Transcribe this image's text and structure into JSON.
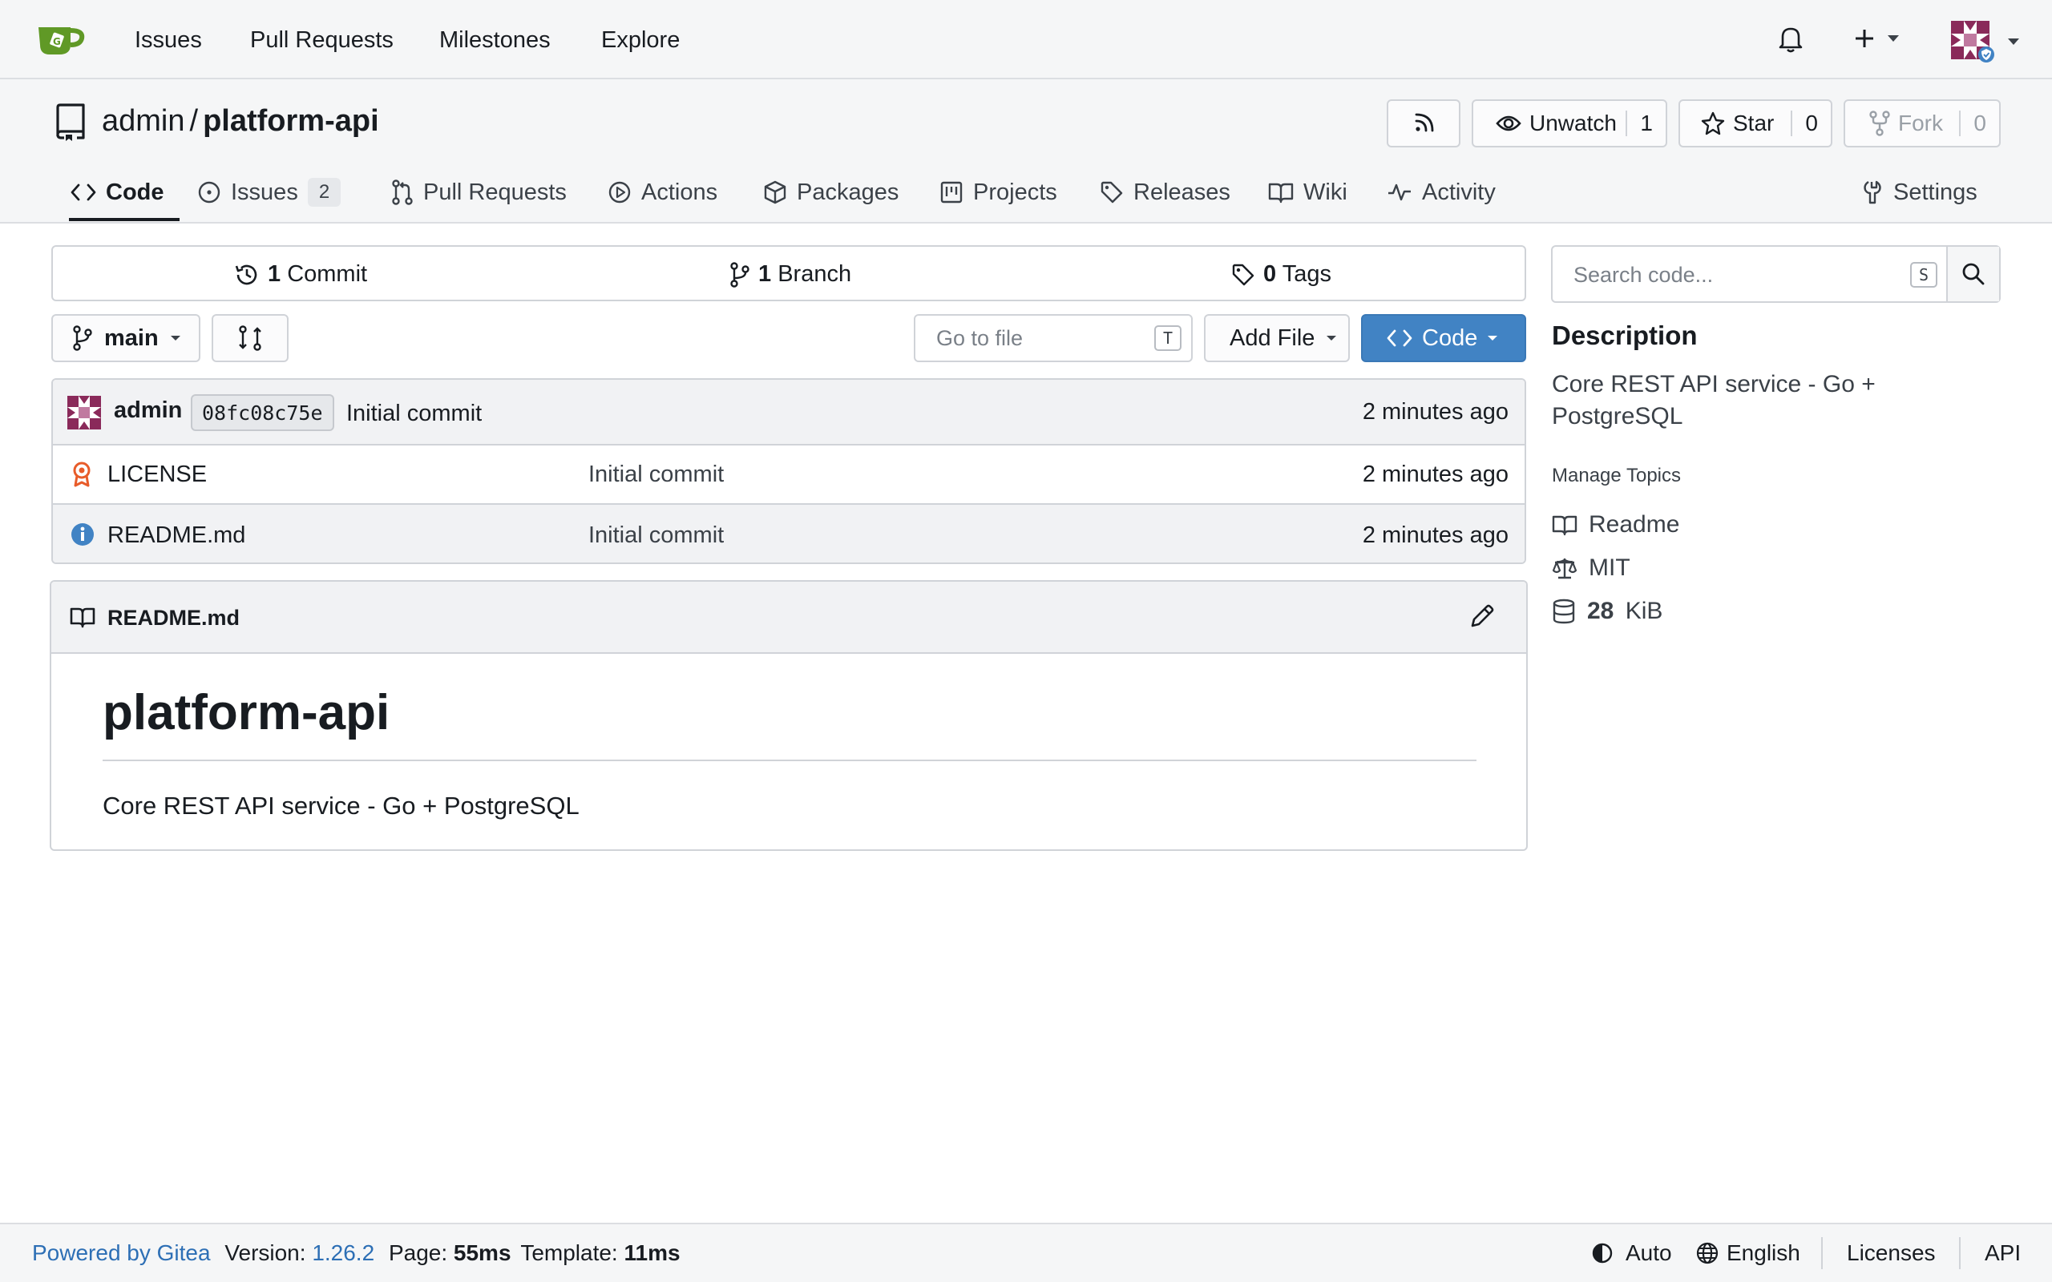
{
  "nav": {
    "links": [
      "Issues",
      "Pull Requests",
      "Milestones",
      "Explore"
    ]
  },
  "repo": {
    "owner": "admin",
    "separator": "/",
    "name": "platform-api",
    "unwatch_label": "Unwatch",
    "watch_count": "1",
    "star_label": "Star",
    "star_count": "0",
    "fork_label": "Fork",
    "fork_count": "0"
  },
  "tabs": {
    "code": "Code",
    "issues": "Issues",
    "issues_count": "2",
    "pulls": "Pull Requests",
    "actions": "Actions",
    "packages": "Packages",
    "projects": "Projects",
    "releases": "Releases",
    "wiki": "Wiki",
    "activity": "Activity",
    "settings": "Settings"
  },
  "stats": {
    "commits_num": "1",
    "commits_label": "Commit",
    "branches_num": "1",
    "branches_label": "Branch",
    "tags_num": "0",
    "tags_label": "Tags"
  },
  "toolbar": {
    "branch": "main",
    "goto_placeholder": "Go to file",
    "goto_key": "T",
    "add_file": "Add File",
    "code": "Code"
  },
  "latest_commit": {
    "author": "admin",
    "sha": "08fc08c75e",
    "message": "Initial commit",
    "time": "2 minutes ago"
  },
  "files": [
    {
      "name": "LICENSE",
      "message": "Initial commit",
      "time": "2 minutes ago",
      "icon": "license-icon"
    },
    {
      "name": "README.md",
      "message": "Initial commit",
      "time": "2 minutes ago",
      "icon": "info-icon"
    }
  ],
  "readme": {
    "filename": "README.md",
    "title": "platform-api",
    "body": "Core REST API service - Go + PostgreSQL"
  },
  "sidebar": {
    "search_placeholder": "Search code...",
    "search_key": "S",
    "description_heading": "Description",
    "description": "Core REST API service - Go + PostgreSQL",
    "manage_topics": "Manage Topics",
    "readme": "Readme",
    "license": "MIT",
    "size_num": "28",
    "size_unit": "KiB"
  },
  "footer": {
    "powered": "Powered by Gitea",
    "version_label": "Version:",
    "version": "1.26.2",
    "page_label": "Page:",
    "page_time": "55ms",
    "template_label": "Template:",
    "template_time": "11ms",
    "theme": "Auto",
    "language": "English",
    "licenses": "Licenses",
    "api": "API"
  },
  "colors": {
    "accent": "#4183c4",
    "link": "#2d6fb5",
    "logo": "#609926",
    "license_icon": "#e85c2a"
  }
}
